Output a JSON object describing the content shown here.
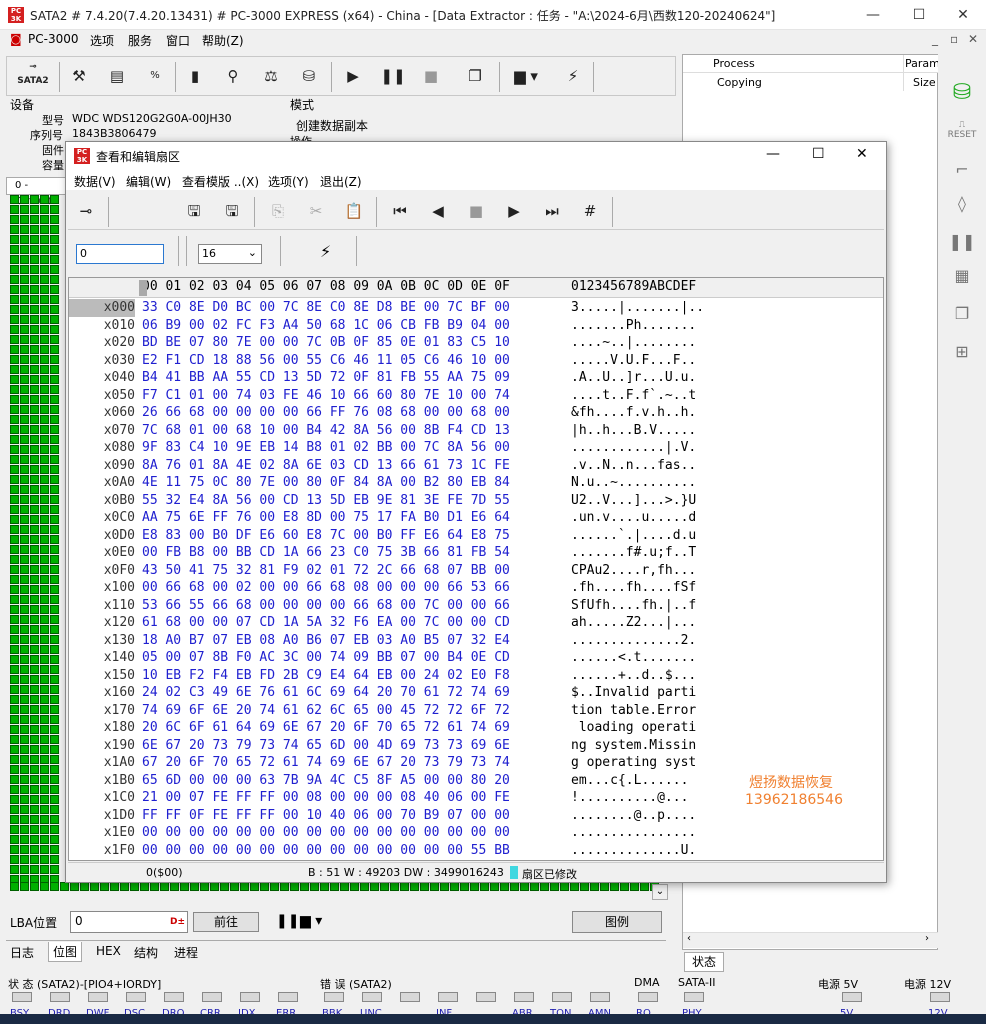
{
  "window": {
    "title": "SATA2 # 7.4.20(7.4.20.13431) # PC-3000 EXPRESS (x64) - China - [Data Extractor : 任务 - \"A:\\2024-6月\\西数120-20240624\"]"
  },
  "menu": {
    "app": "PC-3000",
    "items": [
      "选项",
      "服务",
      "窗口",
      "帮助(Z)"
    ]
  },
  "device": {
    "section": "设备",
    "model_label": "型号",
    "model": "WDC WDS120G2G0A-00JH30",
    "serial_label": "序列号",
    "serial": "1843B3806479",
    "fw_label": "固件",
    "cap_label": "容量",
    "default_tab": "0 - Default"
  },
  "mode": {
    "section": "模式",
    "value": "创建数据副本",
    "op": "操作"
  },
  "toolbar": {
    "sata_label": "SATA2"
  },
  "right_panel": {
    "col_process": "Process",
    "col_param": "Param",
    "row_process": "Copying",
    "row_param": "Size",
    "status_tab": "状态"
  },
  "dialog": {
    "title": "查看和编辑扇区",
    "menu": [
      "数据(V)",
      "编辑(W)",
      "查看模版 ..(X)",
      "选项(Y)",
      "退出(Z)"
    ],
    "offset_value": "0",
    "columns_value": "16",
    "header_bytes": "00 01 02 03 04 05 06 07 08 09 0A 0B 0C 0D 0E 0F",
    "header_ascii": "0123456789ABCDEF",
    "rows": [
      {
        "a": "x000",
        "h": "33 C0 8E D0 BC 00 7C 8E C0 8E D8 BE 00 7C BF 00",
        "t": "3.....|.......|.."
      },
      {
        "a": "x010",
        "h": "06 B9 00 02 FC F3 A4 50 68 1C 06 CB FB B9 04 00",
        "t": ".......Ph......."
      },
      {
        "a": "x020",
        "h": "BD BE 07 80 7E 00 00 7C 0B 0F 85 0E 01 83 C5 10",
        "t": "....~..|........"
      },
      {
        "a": "x030",
        "h": "E2 F1 CD 18 88 56 00 55 C6 46 11 05 C6 46 10 00",
        "t": ".....V.U.F...F.."
      },
      {
        "a": "x040",
        "h": "B4 41 BB AA 55 CD 13 5D 72 0F 81 FB 55 AA 75 09",
        "t": ".A..U..]r...U.u."
      },
      {
        "a": "x050",
        "h": "F7 C1 01 00 74 03 FE 46 10 66 60 80 7E 10 00 74",
        "t": "....t..F.f`.~..t"
      },
      {
        "a": "x060",
        "h": "26 66 68 00 00 00 00 66 FF 76 08 68 00 00 68 00",
        "t": "&fh....f.v.h..h."
      },
      {
        "a": "x070",
        "h": "7C 68 01 00 68 10 00 B4 42 8A 56 00 8B F4 CD 13",
        "t": "|h..h...B.V....."
      },
      {
        "a": "x080",
        "h": "9F 83 C4 10 9E EB 14 B8 01 02 BB 00 7C 8A 56 00",
        "t": "............|.V."
      },
      {
        "a": "x090",
        "h": "8A 76 01 8A 4E 02 8A 6E 03 CD 13 66 61 73 1C FE",
        "t": ".v..N..n...fas.."
      },
      {
        "a": "x0A0",
        "h": "4E 11 75 0C 80 7E 00 80 0F 84 8A 00 B2 80 EB 84",
        "t": "N.u..~.........."
      },
      {
        "a": "x0B0",
        "h": "55 32 E4 8A 56 00 CD 13 5D EB 9E 81 3E FE 7D 55",
        "t": "U2..V...]...>.}U"
      },
      {
        "a": "x0C0",
        "h": "AA 75 6E FF 76 00 E8 8D 00 75 17 FA B0 D1 E6 64",
        "t": ".un.v....u.....d"
      },
      {
        "a": "x0D0",
        "h": "E8 83 00 B0 DF E6 60 E8 7C 00 B0 FF E6 64 E8 75",
        "t": "......`.|....d.u"
      },
      {
        "a": "x0E0",
        "h": "00 FB B8 00 BB CD 1A 66 23 C0 75 3B 66 81 FB 54",
        "t": ".......f#.u;f..T"
      },
      {
        "a": "x0F0",
        "h": "43 50 41 75 32 81 F9 02 01 72 2C 66 68 07 BB 00",
        "t": "CPAu2....r,fh..."
      },
      {
        "a": "x100",
        "h": "00 66 68 00 02 00 00 66 68 08 00 00 00 66 53 66",
        "t": ".fh....fh....fSf"
      },
      {
        "a": "x110",
        "h": "53 66 55 66 68 00 00 00 00 66 68 00 7C 00 00 66",
        "t": "SfUfh....fh.|..f"
      },
      {
        "a": "x120",
        "h": "61 68 00 00 07 CD 1A 5A 32 F6 EA 00 7C 00 00 CD",
        "t": "ah.....Z2...|..."
      },
      {
        "a": "x130",
        "h": "18 A0 B7 07 EB 08 A0 B6 07 EB 03 A0 B5 07 32 E4",
        "t": "..............2."
      },
      {
        "a": "x140",
        "h": "05 00 07 8B F0 AC 3C 00 74 09 BB 07 00 B4 0E CD",
        "t": "......<.t......."
      },
      {
        "a": "x150",
        "h": "10 EB F2 F4 EB FD 2B C9 E4 64 EB 00 24 02 E0 F8",
        "t": "......+..d..$..."
      },
      {
        "a": "x160",
        "h": "24 02 C3 49 6E 76 61 6C 69 64 20 70 61 72 74 69",
        "t": "$..Invalid parti"
      },
      {
        "a": "x170",
        "h": "74 69 6F 6E 20 74 61 62 6C 65 00 45 72 72 6F 72",
        "t": "tion table.Error"
      },
      {
        "a": "x180",
        "h": "20 6C 6F 61 64 69 6E 67 20 6F 70 65 72 61 74 69",
        "t": " loading operati"
      },
      {
        "a": "x190",
        "h": "6E 67 20 73 79 73 74 65 6D 00 4D 69 73 73 69 6E",
        "t": "ng system.Missin"
      },
      {
        "a": "x1A0",
        "h": "67 20 6F 70 65 72 61 74 69 6E 67 20 73 79 73 74",
        "t": "g operating syst"
      },
      {
        "a": "x1B0",
        "h": "65 6D 00 00 00 63 7B 9A 4C C5 8F A5 00 00 80 20",
        "t": "em...c{.L......"
      },
      {
        "a": "x1C0",
        "h": "21 00 07 FE FF FF 00 08 00 00 00 08 40 06 00 FE",
        "t": "!..........@..."
      },
      {
        "a": "x1D0",
        "h": "FF FF 0F FE FF FF 00 10 40 06 00 70 B9 07 00 00",
        "t": "........@..p...."
      },
      {
        "a": "x1E0",
        "h": "00 00 00 00 00 00 00 00 00 00 00 00 00 00 00 00",
        "t": "................"
      },
      {
        "a": "x1F0",
        "h": "00 00 00 00 00 00 00 00 00 00 00 00 00 00 55 BB",
        "t": "..............U."
      }
    ],
    "watermark_line1": "煜扬数据恢复",
    "watermark_line2": "13962186546",
    "status_offset": "0($00)",
    "status_values": "B : 51 W : 49203 DW : 3499016243",
    "status_modified": "扇区已修改"
  },
  "lba": {
    "label": "LBA位置",
    "value": "0",
    "goto": "前往",
    "legend": "图例"
  },
  "tabs": [
    "日志",
    "位图",
    "HEX",
    "结构",
    "进程"
  ],
  "status": {
    "state": "状 态 (SATA2)-[PIO4+IORDY]",
    "error": "错 误 (SATA2)",
    "dma": "DMA",
    "sata": "SATA-II",
    "p5": "电源 5V",
    "p12": "电源 12V",
    "leds1": [
      "BSY",
      "DRD",
      "DWF",
      "DSC",
      "DRQ",
      "CRR",
      "IDX",
      "ERR"
    ],
    "leds2": [
      "BBK",
      "UNC",
      "",
      "INF",
      "",
      "ABR",
      "TON",
      "AMN"
    ],
    "dma_led": "RQ",
    "sata_led": "PHY",
    "p5_led": "5V",
    "p12_led": "12V"
  }
}
